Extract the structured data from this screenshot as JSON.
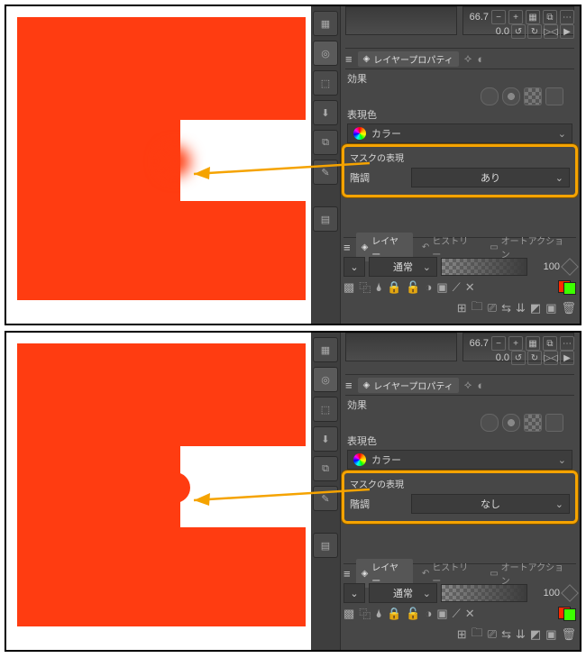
{
  "ui": {
    "zoom": "66.7",
    "rotation": "0.0",
    "header_tab": "レイヤープロパティ",
    "section_effects": "効果",
    "section_expression_color": "表現色",
    "color_label": "カラー",
    "mask_section": "マスクの表現",
    "mask_row_label": "階調",
    "layers_tab": "レイヤー",
    "history_tab": "ヒストリー",
    "auto_action_tab": "オートアクション",
    "blend_mode": "通常",
    "opacity": "100"
  },
  "variant1": {
    "mask_value": "あり"
  },
  "variant2": {
    "mask_value": "なし"
  }
}
